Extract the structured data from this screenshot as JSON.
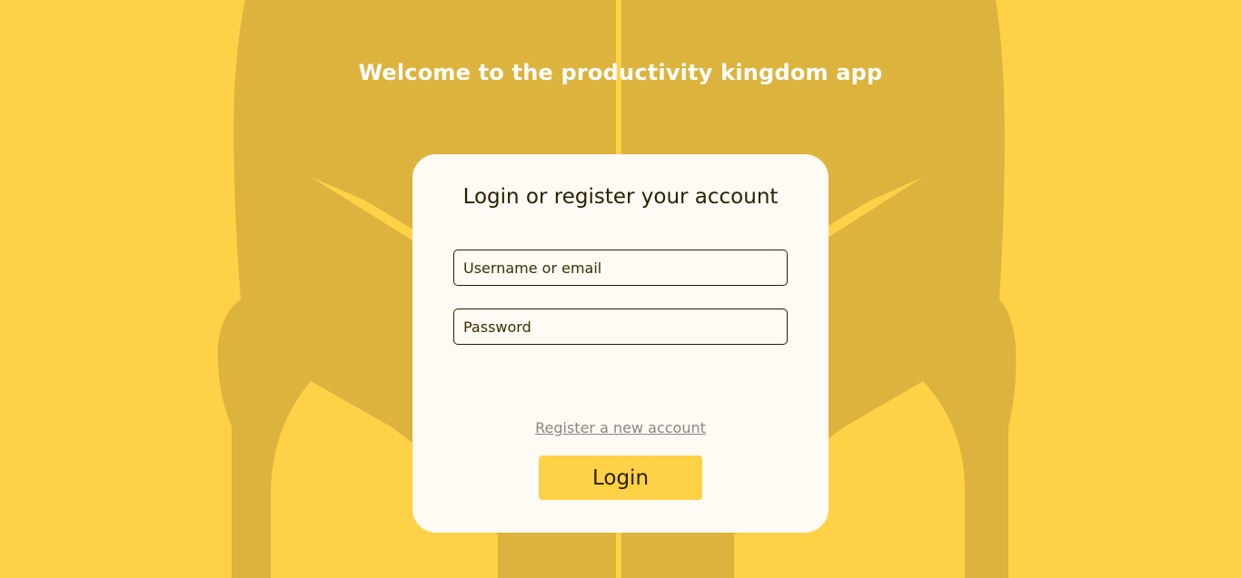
{
  "page": {
    "welcome_title": "Welcome to the productivity kingdom app"
  },
  "login_card": {
    "title": "Login or register your account",
    "username_placeholder": "Username or email",
    "password_placeholder": "Password",
    "register_link_label": "Register a new account",
    "login_button_label": "Login"
  },
  "colors": {
    "background": "#ffd147",
    "helmet_art": "#dcb33d",
    "card_background": "#fffaf3",
    "text_dark": "#2b2102",
    "link_gray": "#8a8680"
  },
  "icons": {
    "background_art": "spartan-helmet-icon"
  }
}
